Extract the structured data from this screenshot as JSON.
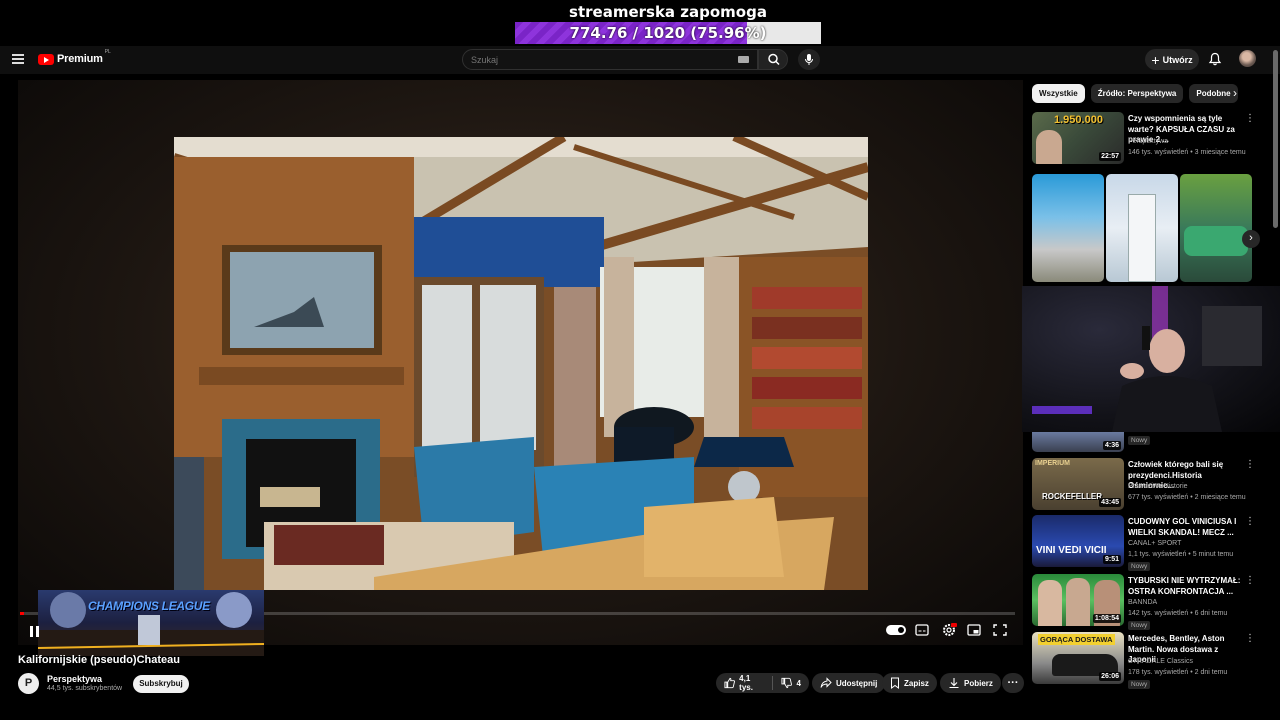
{
  "donation": {
    "title": "streamerska zapomoga",
    "progress_text": "774.76 / 1020 (75.96%)",
    "progress_fraction": 0.7596,
    "fill_color": "#7a24c7"
  },
  "header": {
    "brand": "Premium",
    "region": "PL",
    "search_placeholder": "Szukaj",
    "create_label": "Utwórz"
  },
  "player": {
    "overlay_title": "CHAMPIONS LEAGUE"
  },
  "video": {
    "title": "Kalifornijskie (pseudo)Chateau",
    "channel_initial": "P",
    "channel_name": "Perspektywa",
    "subscribers": "44,5 tys. subskrybentów",
    "subscribe_label": "Subskrybuj",
    "likes": "4,1 tys.",
    "dislikes": "4",
    "share_label": "Udostępnij",
    "save_label": "Zapisz",
    "download_label": "Pobierz"
  },
  "sidebar": {
    "chips": [
      "Wszystkie",
      "Źródło: Perspektywa",
      "Podobne"
    ],
    "rec_top": {
      "title": "Czy wspomnienia są tyle warte? KAPSUŁA CZASU za prawie 2 ...",
      "channel": "Perspektywa",
      "meta": "146 tys. wyświetleń • 3 miesiące temu",
      "duration": "22:57",
      "thumb_text": "1.950.000"
    },
    "rec_partial": {
      "duration": "4:36",
      "badge": "Nowy"
    },
    "recs": [
      {
        "title": "Człowiek którego bali się prezydenci.Historia Ośmiornic...",
        "channel": "Prawdziwe Historie",
        "meta": "677 tys. wyświetleń • 2 miesiące temu",
        "duration": "43:45",
        "badge": "",
        "thumb_text": "ROCKEFELLER"
      },
      {
        "title": "CUDOWNY GOL VINICIUSA I WIELKI SKANDAL! MECZ ...",
        "channel": "CANAL+ SPORT",
        "meta": "1,1 tys. wyświetleń • 5 minut temu",
        "duration": "9:51",
        "badge": "Nowy",
        "thumb_text": "VINI VEDI VICII"
      },
      {
        "title": "TYBURSKI NIE WYTRZYMAŁ: OSTRA KONFRONTACJA ...",
        "channel": "BANNDA",
        "meta": "142 tys. wyświetleń • 6 dni temu",
        "duration": "1:08:54",
        "badge": "Nowy",
        "thumb_text": ""
      },
      {
        "title": "Mercedes, Bentley, Aston Martin. Nowa dostawa z Japonii",
        "channel": "STRADALE Classics",
        "meta": "178 tys. wyświetleń • 2 dni temu",
        "duration": "26:06",
        "badge": "Nowy",
        "thumb_text": "GORĄCA DOSTAWA"
      }
    ]
  }
}
